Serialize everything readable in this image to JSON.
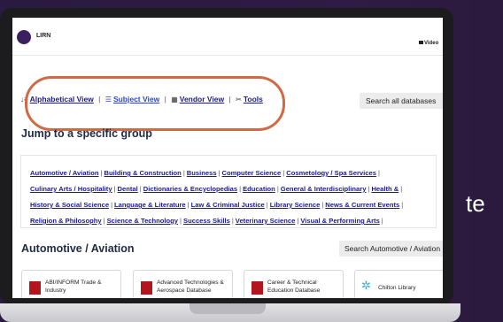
{
  "brand": {
    "logo_text": "LIRN",
    "video_label": "Video"
  },
  "view_nav": {
    "alphabetical": "Alphabetical View",
    "subject": "Subject View",
    "vendor": "Vendor View",
    "tools": "Tools",
    "separator": "|"
  },
  "search_all": "Search all databases",
  "jump_title": "Jump to a specific group",
  "groups_rows": [
    [
      "Automotive / Aviation",
      "Building & Construction",
      "Business",
      "Computer Science",
      "Cosmetology / Spa Services"
    ],
    [
      "Culinary Arts / Hospitality",
      "Dental",
      "Dictionaries & Encyclopedias",
      "Education",
      "General & Interdisciplinary",
      "Health &"
    ],
    [
      "History & Social Science",
      "Language & Literature",
      "Law & Criminal Justice",
      "Library Science",
      "News & Current Events"
    ],
    [
      "Religion & Philosophy",
      "Science & Technology",
      "Success Skills",
      "Veterinary Science",
      "Visual & Performing Arts"
    ]
  ],
  "section": {
    "title": "Automotive / Aviation",
    "search": "Search Automotive / Aviation"
  },
  "cards": [
    {
      "title": "ABI/INFORM Trade & Industry",
      "icon": "proquest-icon"
    },
    {
      "title": "Advanced Technologies & Aerospace Database",
      "icon": "proquest-icon"
    },
    {
      "title": "Career & Technical Education Database",
      "icon": "proquest-icon"
    },
    {
      "title": "Chilton Library",
      "icon": "chilton-icon"
    }
  ],
  "side_text": "te",
  "colors": {
    "background": "#2b1a3d",
    "highlight_oval": "#d06a45",
    "link": "#1a1a8c"
  }
}
